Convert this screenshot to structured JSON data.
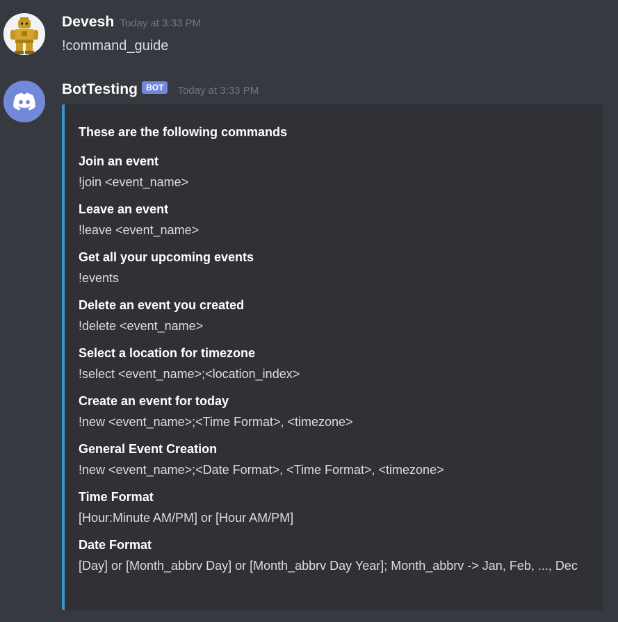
{
  "messages": [
    {
      "username": "Devesh",
      "timestamp": "Today at 3:33 PM",
      "content": "!command_guide",
      "avatar_icon": "lego-figure-avatar"
    },
    {
      "username": "BotTesting",
      "badge": "BOT",
      "timestamp": "Today at 3:33 PM",
      "avatar_icon": "discord-logo-avatar"
    }
  ],
  "embed": {
    "accent_color": "#3a93d8",
    "title": "These are the following commands",
    "fields": [
      {
        "name": "Join an event",
        "value": "!join <event_name>"
      },
      {
        "name": "Leave an event",
        "value": "!leave <event_name>"
      },
      {
        "name": "Get all your upcoming events",
        "value": "!events"
      },
      {
        "name": "Delete an event you created",
        "value": "!delete <event_name>"
      },
      {
        "name": "Select a location for timezone",
        "value": "!select <event_name>;<location_index>"
      },
      {
        "name": "Create an event for today",
        "value": "!new <event_name>;<Time Format>, <timezone>"
      },
      {
        "name": "General Event Creation",
        "value": "!new <event_name>;<Date Format>, <Time Format>, <timezone>"
      },
      {
        "name": "Time Format",
        "value": "[Hour:Minute AM/PM] or [Hour AM/PM]"
      },
      {
        "name": "Date Format",
        "value": "[Day] or [Month_abbrv Day] or [Month_abbrv Day Year]; Month_abbrv -> Jan, Feb, ..., Dec"
      }
    ]
  },
  "colors": {
    "background": "#36393f",
    "embed_background": "#2f3136",
    "bot_badge": "#7289da",
    "timestamp": "#72767d"
  }
}
